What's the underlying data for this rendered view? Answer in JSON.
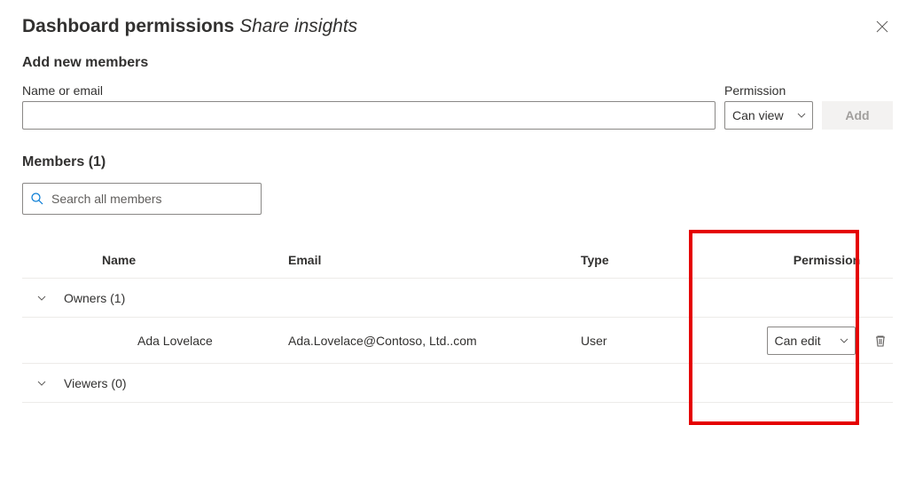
{
  "dialog": {
    "title_prefix": "Dashboard permissions ",
    "title_italic": "Share insights"
  },
  "add": {
    "section_label": "Add new members",
    "name_label": "Name or email",
    "name_value": "",
    "permission_label": "Permission",
    "permission_value": "Can view",
    "add_button_label": "Add"
  },
  "members": {
    "header": "Members (1)",
    "search_placeholder": "Search all members"
  },
  "table": {
    "col_name": "Name",
    "col_email": "Email",
    "col_type": "Type",
    "col_permission": "Permission"
  },
  "groups": {
    "owners_label": "Owners (1)",
    "viewers_label": "Viewers (0)"
  },
  "rows": {
    "r0": {
      "name": "Ada Lovelace",
      "email": "Ada.Lovelace@Contoso, Ltd..com",
      "type": "User",
      "permission": "Can edit"
    }
  }
}
